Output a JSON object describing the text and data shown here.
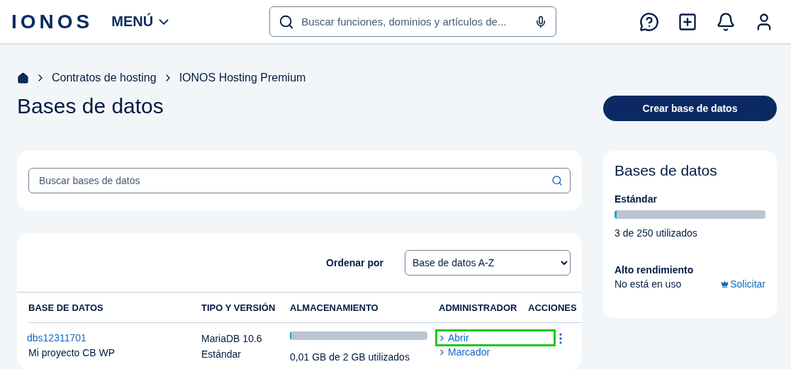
{
  "header": {
    "logo": "IONOS",
    "menu": "MENÚ",
    "search": {
      "placeholder": "Buscar funciones, dominios y artículos de..."
    }
  },
  "breadcrumb": [
    "Contratos de hosting",
    "IONOS Hosting Premium"
  ],
  "title": "Bases de datos",
  "create_button": "Crear base de datos",
  "db_search": {
    "placeholder": "Buscar bases de datos"
  },
  "sort": {
    "label": "Ordenar por",
    "value": "Base de datos A-Z"
  },
  "table": {
    "columns": [
      "BASE DE DATOS",
      "TIPO Y VERSIÓN",
      "ALMACENAMIENTO",
      "ADMINISTRADOR",
      "ACCIONES"
    ],
    "rows": [
      {
        "name": "dbs12311701",
        "description": "Mi proyecto CB WP",
        "type": "MariaDB 10.6",
        "edition": "Estándar",
        "storage": {
          "level": 0.005,
          "usage": "0,01 GB de 2 GB utilizados"
        },
        "links": [
          {
            "label": "Abrir",
            "highlighted": true
          },
          {
            "label": "Marcador",
            "highlighted": false
          }
        ]
      }
    ]
  },
  "summary": {
    "title": "Bases de datos",
    "standard": {
      "label": "Estándar",
      "level": 0.012,
      "usage": "3 de 250 utilizados"
    },
    "high_performance": {
      "label": "Alto rendimiento",
      "status": "No está en uso",
      "action": "Solicitar"
    }
  }
}
